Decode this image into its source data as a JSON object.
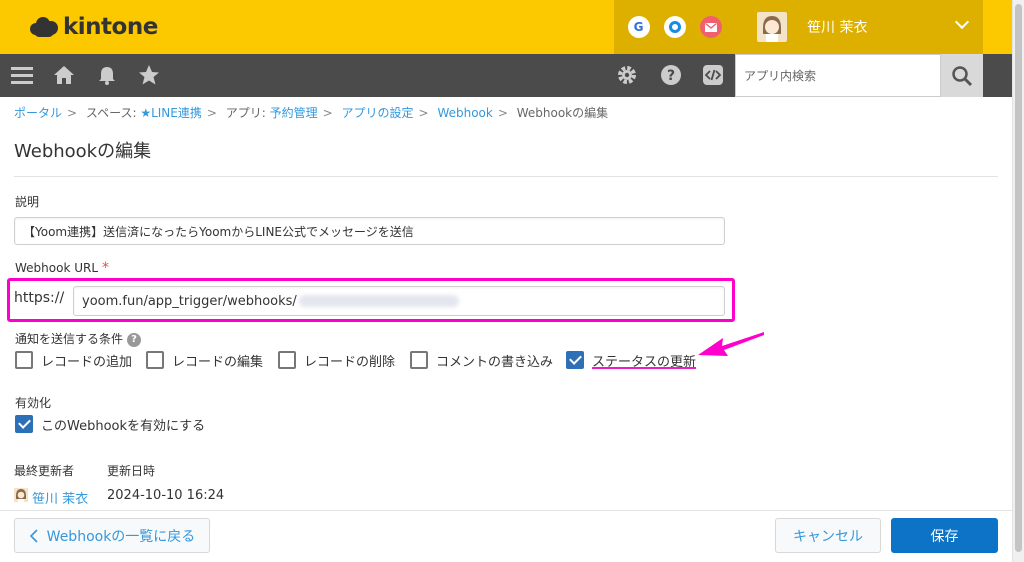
{
  "header": {
    "logo_text": "kintone",
    "user_name": "笹川 茉衣",
    "icon_g_letter": "G"
  },
  "toolbar": {
    "search_placeholder": "アプリ内検索"
  },
  "breadcrumb": {
    "items": [
      "ポータル",
      "スペース: ",
      "★LINE連携",
      "アプリ: ",
      "予約管理",
      "アプリの設定",
      "Webhook",
      "Webhookの編集"
    ],
    "separator": ">"
  },
  "page": {
    "title": "Webhookの編集"
  },
  "form": {
    "description_label": "説明",
    "description_value": "【Yoom連携】送信済になったらYoomからLINE公式でメッセージを送信",
    "url_label": "Webhook URL",
    "required_mark": "*",
    "url_prefix": "https://",
    "url_value": "yoom.fun/app_trigger/webhooks/",
    "conditions_label": "通知を送信する条件",
    "help_glyph": "?",
    "conditions": [
      {
        "label": "レコードの追加",
        "checked": false
      },
      {
        "label": "レコードの編集",
        "checked": false
      },
      {
        "label": "レコードの削除",
        "checked": false
      },
      {
        "label": "コメントの書き込み",
        "checked": false
      },
      {
        "label": "ステータスの更新",
        "checked": true
      }
    ],
    "enable_label": "有効化",
    "enable_checkbox_label": "このWebhookを有効にする",
    "enable_checked": true
  },
  "meta": {
    "updated_by_label": "最終更新者",
    "updated_at_label": "更新日時",
    "updated_by": "笹川 茉衣",
    "updated_at": "2024-10-10 16:24"
  },
  "footer": {
    "back_label": "Webhookの一覧に戻る",
    "cancel_label": "キャンセル",
    "save_label": "保存"
  },
  "colors": {
    "header_bg": "#fcc800",
    "toolbar_bg": "#4b4b4b",
    "link": "#3498db",
    "primary": "#0d73c6",
    "highlight": "#ff00cc"
  }
}
